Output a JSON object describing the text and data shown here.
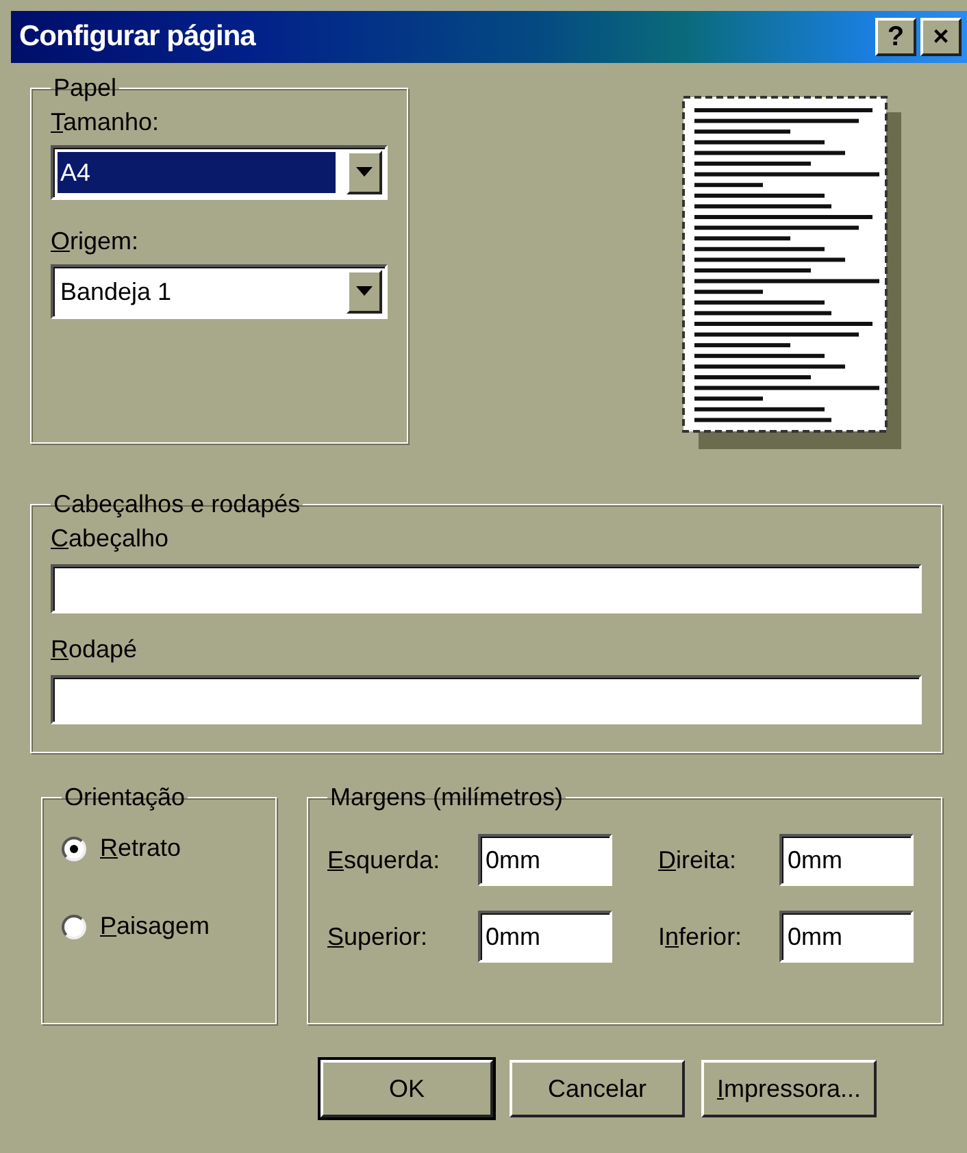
{
  "window": {
    "title": "Configurar página",
    "title_buttons": [
      "?",
      "×"
    ]
  },
  "paper": {
    "legend": "Papel",
    "fields": [
      {
        "label": {
          "key": "T",
          "post": "amanho:"
        },
        "value": "A4",
        "highlighted": true
      },
      {
        "label": {
          "key": "O",
          "post": "rigem:"
        },
        "value": "Bandeja 1",
        "highlighted": false
      }
    ]
  },
  "headers_footers": {
    "legend": "Cabeçalhos e rodapés",
    "fields": [
      {
        "label": {
          "key": "C",
          "post": "abeçalho"
        }
      },
      {
        "label": {
          "key": "R",
          "post": "odapé"
        }
      }
    ]
  },
  "orientation": {
    "legend": "Orientação",
    "options": [
      {
        "label": {
          "key": "R",
          "post": "etrato"
        },
        "selected": true
      },
      {
        "label": {
          "key": "P",
          "post": "aisagem"
        },
        "selected": false
      }
    ]
  },
  "margins": {
    "legend": "Margens (milímetros)",
    "fields": [
      {
        "label": {
          "key": "E",
          "post": "squerda:"
        },
        "value": "0mm"
      },
      {
        "label": {
          "key": "D",
          "post": "ireita:"
        },
        "value": "0mm"
      },
      {
        "label": {
          "key": "S",
          "post": "uperior:"
        },
        "value": "0mm"
      },
      {
        "label": {
          "pre": "I",
          "key": "n",
          "post": "ferior:"
        },
        "value": "0mm"
      }
    ]
  },
  "buttons": [
    {
      "label": {
        "post": "OK"
      },
      "default": true
    },
    {
      "label": {
        "post": "Cancelar"
      },
      "default": false
    },
    {
      "label": {
        "key": "I",
        "post": "mpressora..."
      },
      "default": false
    }
  ]
}
